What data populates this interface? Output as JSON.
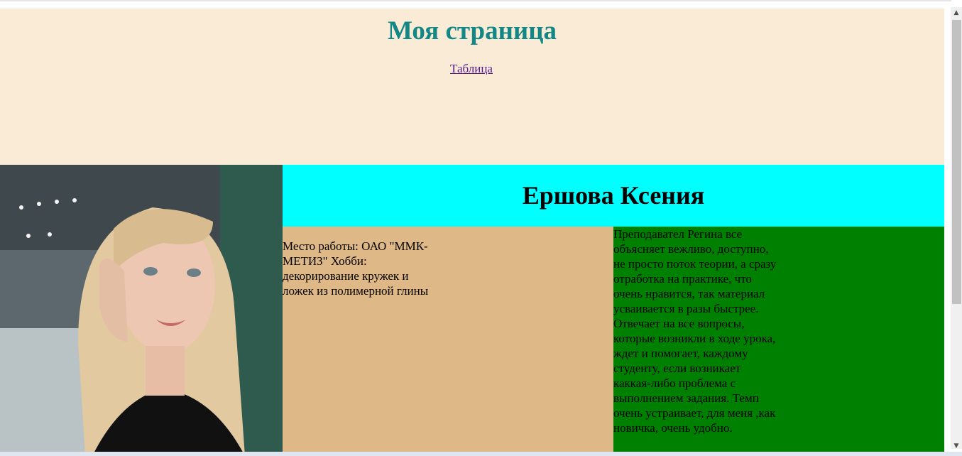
{
  "header": {
    "title": "Моя страница",
    "link_label": "Таблица"
  },
  "profile": {
    "photo_alt": "photo-of-woman",
    "name": "Ершова Ксения",
    "work_info": "Место работы: ОАО \"ММК-МЕТИЗ\" Хобби: декорирование кружек и ложек из полимерной глины",
    "review": "Преподавател Регина все объясняет вежливо, доступно, не просто поток теории, а сразу отработка на практике, что очень нравится, так материал усваивается в разы быстрее. Отвечает на все вопросы, которые возникли в ходе урока, ждет и помогает, каждому студенту, если возникает каккая-либо проблема с выполнением задания. Темп очень устраивает, для меня ,как новичка, очень удобно."
  },
  "colors": {
    "header_bg": "#faebd7",
    "title_color": "#128786",
    "name_bg": "#00ffff",
    "work_bg": "#deb887",
    "review_bg": "#008000"
  }
}
